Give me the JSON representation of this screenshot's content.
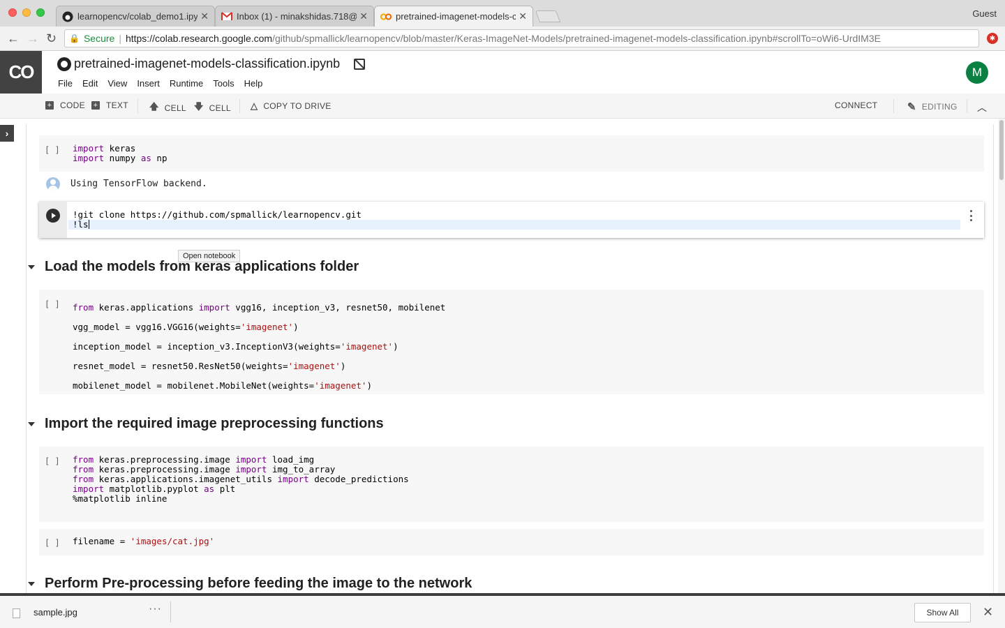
{
  "browser": {
    "tabs": [
      {
        "title": "learnopencv/colab_demo1.ipyn",
        "favicon": "github-icon"
      },
      {
        "title": "Inbox (1) - minakshidas.718@g",
        "favicon": "gmail-icon"
      },
      {
        "title": "pretrained-imagenet-models-c",
        "favicon": "colab-icon"
      }
    ],
    "tab_close": "✕",
    "profile": "Guest",
    "secure_label": "Secure",
    "url_host": "https://colab.research.google.com",
    "url_path": "/github/spmallick/learnopencv/blob/master/Keras-ImageNet-Models/pretrained-imagenet-models-classification.ipynb#scrollTo=oWi6-UrdIM3E"
  },
  "colab": {
    "logo": "CO",
    "notebook_title": "pretrained-imagenet-models-classification.ipynb",
    "menu": [
      "File",
      "Edit",
      "View",
      "Insert",
      "Runtime",
      "Tools",
      "Help"
    ],
    "avatar_letter": "M"
  },
  "toolbar": {
    "code": "CODE",
    "text": "TEXT",
    "cell_up": "CELL",
    "cell_down": "CELL",
    "copy_to_drive": "COPY TO DRIVE",
    "connect": "CONNECT",
    "editing": "EDITING"
  },
  "cells": {
    "prompt": "[ ]",
    "c1": {
      "l1_kw": "import",
      "l1_rest": " keras",
      "l2_kw": "import",
      "l2_mid": " numpy ",
      "l2_kw2": "as",
      "l2_rest": " np"
    },
    "c1_output": "Using TensorFlow backend.",
    "c2": {
      "l1": "!git clone https://github.com/spmallick/learnopencv.git",
      "l2": "!ls"
    },
    "tooltip": "Open notebook",
    "section1": "Load the models from keras applications folder",
    "c3": {
      "l1_kw": "from",
      "l1_mid": " keras.applications ",
      "l1_kw2": "import",
      "l1_rest": " vgg16, inception_v3, resnet50, mobilenet",
      "l2_pre": "vgg_model = vgg16.VGG16(weights=",
      "l2_str": "'imagenet'",
      "l2_post": ")",
      "l3_pre": "inception_model = inception_v3.InceptionV3(weights=",
      "l3_str": "'imagenet'",
      "l3_post": ")",
      "l4_pre": "resnet_model = resnet50.ResNet50(weights=",
      "l4_str": "'imagenet'",
      "l4_post": ")",
      "l5_pre": "mobilenet_model = mobilenet.MobileNet(weights=",
      "l5_str": "'imagenet'",
      "l5_post": ")"
    },
    "section2": "Import the required image preprocessing functions",
    "c4": {
      "l1_kw": "from",
      "l1_mid": " keras.preprocessing.image ",
      "l1_kw2": "import",
      "l1_rest": " load_img",
      "l2_kw": "from",
      "l2_mid": " keras.preprocessing.image ",
      "l2_kw2": "import",
      "l2_rest": " img_to_array",
      "l3_kw": "from",
      "l3_mid": " keras.applications.imagenet_utils ",
      "l3_kw2": "import",
      "l3_rest": " decode_predictions",
      "l4_kw": "import",
      "l4_mid": " matplotlib.pyplot ",
      "l4_kw2": "as",
      "l4_rest": " plt",
      "l5": "%matplotlib inline"
    },
    "c5": {
      "pre": "filename = ",
      "str": "'images/cat.jpg'"
    },
    "section3": "Perform Pre-processing before feeding the image to the network"
  },
  "downloads": {
    "file_name": "sample.jpg",
    "more": "···",
    "show_all": "Show All",
    "close": "✕"
  }
}
